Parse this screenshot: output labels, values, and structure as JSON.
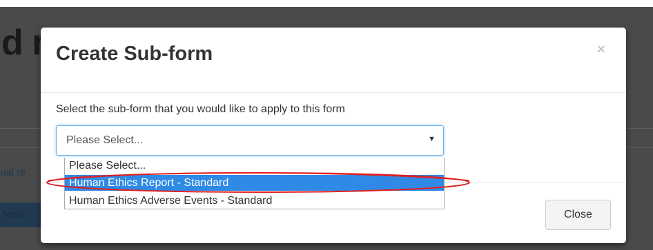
{
  "background": {
    "heading": "d report test",
    "link_text": "ual re",
    "button_label": "New"
  },
  "modal": {
    "title": "Create Sub-form",
    "close_symbol": "×",
    "prompt": "Select the sub-form that you would like to apply to this form",
    "select": {
      "value": "Please Select...",
      "caret": "▼",
      "options": [
        "Please Select...",
        "Human Ethics Report - Standard",
        "Human Ethics Adverse Events - Standard"
      ],
      "highlighted_option": "Human Ethics Report - Standard"
    },
    "footer": {
      "close_label": "Close"
    }
  },
  "colors": {
    "backdrop": "#4a4a4a",
    "highlight": "#2f8ae6",
    "annotation": "#e02020",
    "focus_border": "#66afe9"
  }
}
